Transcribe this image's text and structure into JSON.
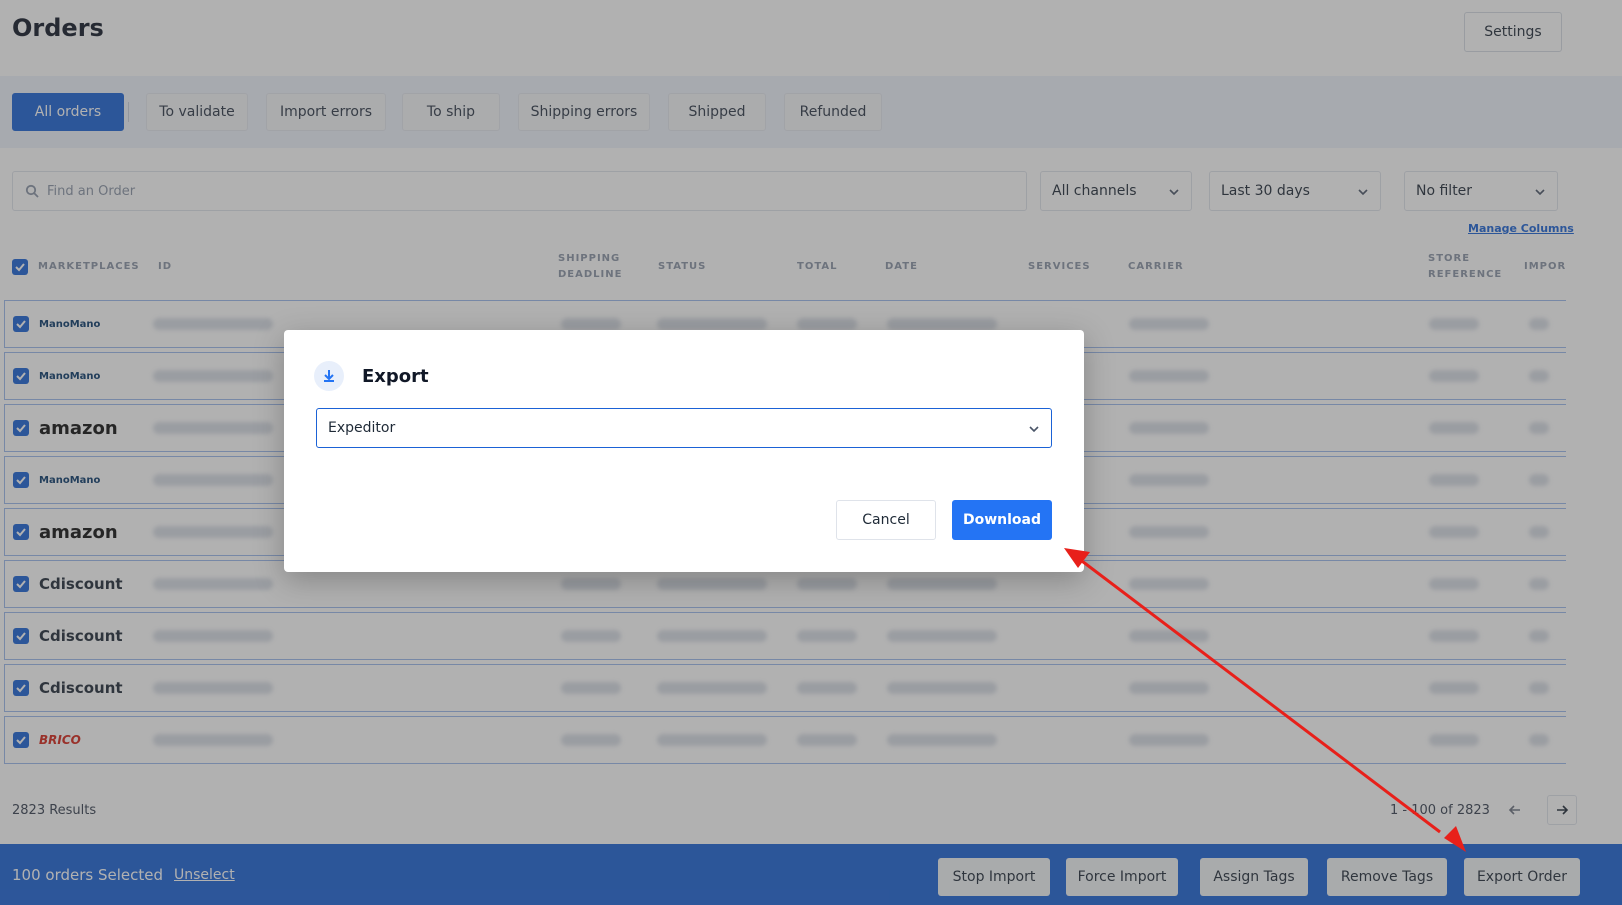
{
  "header": {
    "title": "Orders",
    "settings_label": "Settings"
  },
  "tabs": [
    {
      "label": "All orders",
      "active": true
    },
    {
      "label": "To validate"
    },
    {
      "label": "Import errors"
    },
    {
      "label": "To ship"
    },
    {
      "label": "Shipping errors"
    },
    {
      "label": "Shipped"
    },
    {
      "label": "Refunded"
    }
  ],
  "filters": {
    "search_placeholder": "Find an Order",
    "channels": "All channels",
    "period": "Last 30 days",
    "filter": "No filter",
    "manage_columns": "Manage Columns"
  },
  "table": {
    "columns": {
      "marketplaces": "MARKETPLACES",
      "id": "ID",
      "shipping_deadline": [
        "SHIPPING",
        "DEADLINE"
      ],
      "status": "STATUS",
      "total": "TOTAL",
      "date": "DATE",
      "services": "SERVICES",
      "carrier": "CARRIER",
      "store_reference": [
        "STORE",
        "REFERENCE"
      ],
      "import": "IMPOR"
    },
    "rows": [
      {
        "marketplace": "ManoMano",
        "checked": true
      },
      {
        "marketplace": "ManoMano",
        "checked": true
      },
      {
        "marketplace": "amazon",
        "checked": true
      },
      {
        "marketplace": "ManoMano",
        "checked": true
      },
      {
        "marketplace": "amazon",
        "checked": true
      },
      {
        "marketplace": "Cdiscount",
        "checked": true
      },
      {
        "marketplace": "Cdiscount",
        "checked": true
      },
      {
        "marketplace": "Cdiscount",
        "checked": true
      },
      {
        "marketplace": "BRICO",
        "checked": true
      }
    ]
  },
  "footer": {
    "results": "2823 Results",
    "pagination": "1 - 100 of 2823",
    "selected": "100 orders Selected",
    "unselect": "Unselect"
  },
  "actions": [
    "Stop Import",
    "Force Import",
    "Assign Tags",
    "Remove Tags",
    "Export Order"
  ],
  "modal": {
    "title": "Export",
    "format": "Expeditor",
    "cancel": "Cancel",
    "download": "Download"
  },
  "colors": {
    "primary": "#1b62d6",
    "download": "#2474f4",
    "annotation": "#e8201a"
  }
}
